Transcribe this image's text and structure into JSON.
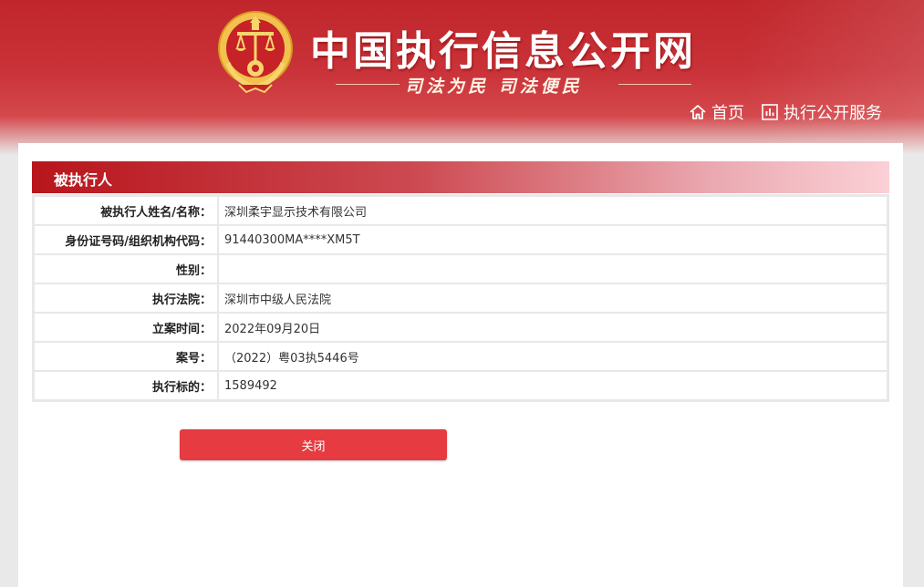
{
  "header": {
    "site_title": "中国执行信息公开网",
    "slogan": "司法为民  司法便民",
    "nav": [
      {
        "label": "首页",
        "icon": "home-icon"
      },
      {
        "label": "执行公开服务",
        "icon": "chart-icon"
      }
    ]
  },
  "section": {
    "title": "被执行人"
  },
  "details": [
    {
      "label": "被执行人姓名/名称：",
      "value": "深圳柔宇显示技术有限公司"
    },
    {
      "label": "身份证号码/组织机构代码：",
      "value": "91440300MA****XM5T"
    },
    {
      "label": "性别：",
      "value": ""
    },
    {
      "label": "执行法院：",
      "value": "深圳市中级人民法院"
    },
    {
      "label": "立案时间：",
      "value": "2022年09月20日"
    },
    {
      "label": "案号：",
      "value": "（2022）粤03执5446号"
    },
    {
      "label": "执行标的：",
      "value": "1589492"
    }
  ],
  "actions": {
    "close_label": "关闭"
  },
  "colors": {
    "header_red": "#c0262b",
    "button_red": "#e63b40",
    "emblem_gold": "#f2c14e"
  }
}
